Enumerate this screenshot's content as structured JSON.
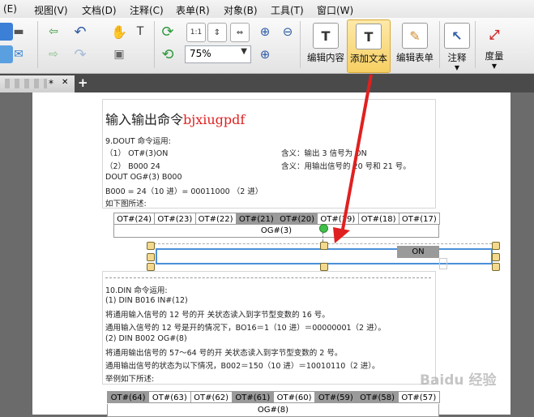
{
  "menu": [
    "(E)",
    "视图(V)",
    "文档(D)",
    "注释(C)",
    "表单(R)",
    "对象(B)",
    "工具(T)",
    "窗口(W)"
  ],
  "toolbar": {
    "zoom_value": "75%",
    "edit_content": "编辑内容",
    "add_text": "添加文本",
    "edit_form": "编辑表单",
    "annotate": "注释",
    "measure": "度量"
  },
  "tab": {
    "title": "*",
    "close": "✕",
    "add": "+"
  },
  "doc": {
    "title": "输入输出命令",
    "title_red": "bjxiugpdf",
    "dout_heading": "9.DOUT  命令运用:",
    "dout_line1": "（1）  OT#(3)ON",
    "dout_line1_meaning": "含义：输出 3 信号为 ON",
    "dout_line2": "（2）  B000 24",
    "dout_line2_meaning": "含义：用输出信号的 20 号和 21 号。",
    "dout_line3": "DOUT OG#(3) B000",
    "dout_line4": "B000 = 24（10 进）= 00011000 （2 进）",
    "dout_line5": "如下图所述:",
    "ot_row1": [
      "OT#(24)",
      "OT#(23)",
      "OT#(22)",
      "OT#(21)",
      "OT#(20)",
      "OT#(19)",
      "OT#(18)",
      "OT#(17)"
    ],
    "og_row1": "OG#(3)",
    "on_label": "ON",
    "din_heading": "10.DIN  命令运用:",
    "din_line1": "(1) DIN B016 IN#(12)",
    "din_line2": "将通用输入信号的 12 号的开 关状态读入到字节型变数的 16 号。",
    "din_line3": "通用输入信号的 12 号是开的情况下，BO16＝1（10 进）＝00000001（2 进）。",
    "din_line4": "(2) DIN B002 OG#(8)",
    "din_line5": "将通用输出信号的 57～64 号的开 关状态读入到字节型变数的 2 号。",
    "din_line6": "通用输出信号的状态为以下情况，B002＝150（10 进）＝10010110（2 进）。",
    "din_line7": "举例如下所述:",
    "ot_row2": [
      "OT#(64)",
      "OT#(63)",
      "OT#(62)",
      "OT#(61)",
      "OT#(60)",
      "OT#(59)",
      "OT#(58)",
      "OT#(57)"
    ],
    "og_row2": "OG#(8)"
  },
  "watermark": "Baidu 经验",
  "colors": {
    "accent_red": "#e02020",
    "active_button": "#f7cf63",
    "selection": "#4a90d9"
  }
}
